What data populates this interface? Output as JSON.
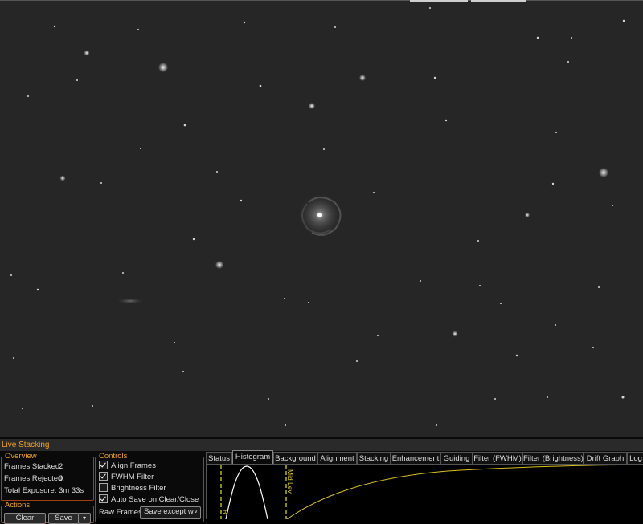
{
  "panel": {
    "title": "Live Stacking",
    "overview": {
      "legend": "Overview",
      "frames_stacked_label": "Frames Stacked:",
      "frames_stacked_value": "2",
      "frames_rejected_label": "Frames Rejected:",
      "frames_rejected_value": "0",
      "total_exposure_label": "Total Exposure:",
      "total_exposure_value": "3m 33s"
    },
    "actions": {
      "legend": "Actions",
      "clear_label": "Clear",
      "save_label": "Save"
    },
    "controls": {
      "legend": "Controls",
      "checkboxes": [
        {
          "label": "Align Frames",
          "checked": true
        },
        {
          "label": "FWHM Filter",
          "checked": true
        },
        {
          "label": "Brightness Filter",
          "checked": false
        },
        {
          "label": "Auto Save on Clear/Close",
          "checked": true
        }
      ],
      "raw_frames_label": "Raw Frames",
      "raw_frames_value": "Save except w"
    },
    "tabs": [
      {
        "label": "Status",
        "active": false
      },
      {
        "label": "Histogram",
        "active": true
      },
      {
        "label": "Background",
        "active": false
      },
      {
        "label": "Alignment",
        "active": false
      },
      {
        "label": "Stacking",
        "active": false
      },
      {
        "label": "Enhancement",
        "active": false
      },
      {
        "label": "Guiding",
        "active": false
      },
      {
        "label": "Filter (FWHM)",
        "active": false
      },
      {
        "label": "Filter (Brightness)",
        "active": false
      },
      {
        "label": "Drift Graph",
        "active": false
      },
      {
        "label": "Log",
        "active": false
      }
    ],
    "histogram": {
      "mid_level_label": "Mid Lev",
      "black_level_label": "B",
      "colors": {
        "curve": "#ffffff",
        "stretch": "#d8c020",
        "marker": "#e8e020"
      }
    }
  },
  "colors": {
    "accent": "#f0a020",
    "border": "#a04010",
    "sky": "#262626"
  }
}
